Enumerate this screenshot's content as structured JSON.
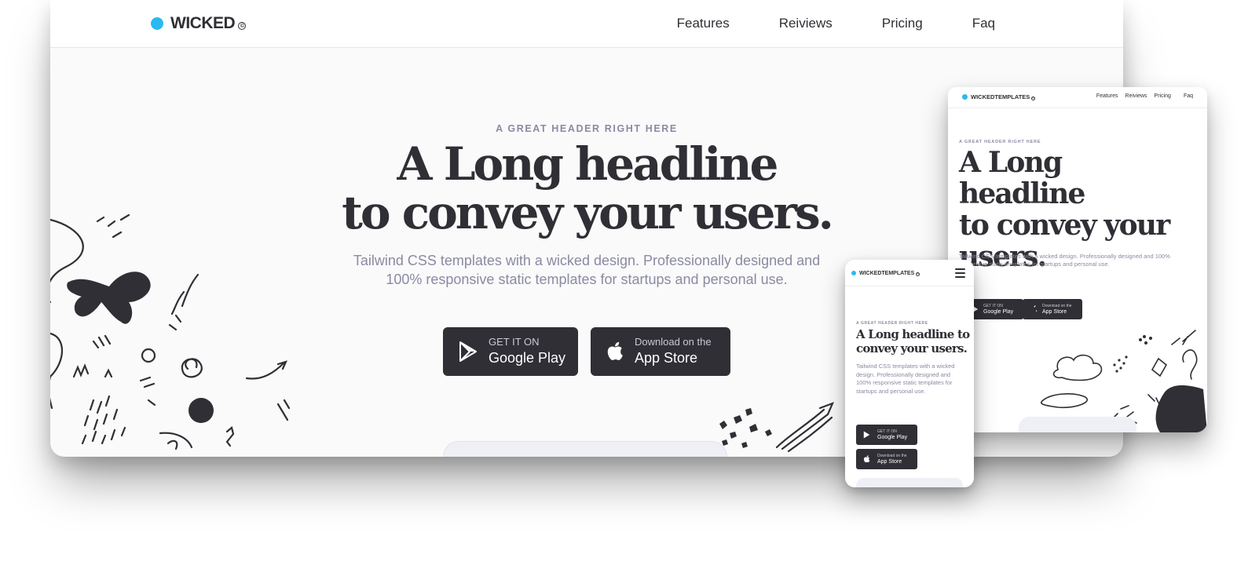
{
  "colors": {
    "accent": "#2ab9f0",
    "dark": "#2f2f35",
    "muted": "#8a8aa3",
    "background": "#fafafa"
  },
  "desktop": {
    "brand": "WICKED",
    "brand_mark": "©",
    "nav": [
      "Features",
      "Reiviews",
      "Pricing",
      "Faq"
    ],
    "eyebrow": "A GREAT HEADER RIGHT HERE",
    "headline_line1": "A Long headline",
    "headline_line2": "to convey your users.",
    "subtext_line1": "Tailwind CSS templates with a wicked design. Professionally designed and",
    "subtext_line2": "100% responsive static templates for startups and personal use.",
    "google_play": {
      "small": "GET IT ON",
      "big": "Google Play",
      "icon": "google-play-icon"
    },
    "app_store": {
      "small": "Download on the",
      "big": "App Store",
      "icon": "apple-icon"
    }
  },
  "tablet": {
    "brand": "WICKEDTEMPLATES",
    "brand_mark": "©",
    "nav": [
      "Features",
      "Reiviews",
      "Pricing",
      "Faq"
    ],
    "eyebrow": "A GREAT HEADER RIGHT HERE",
    "headline_line1": "A Long headline",
    "headline_line2": "to convey your",
    "headline_line3": "users.",
    "subtext_line1": "Tailwind CSS templates with a wicked design. Professionally designed and 100%",
    "subtext_line2": "responsive static templates for startups and personal use.",
    "google_play": {
      "small": "GET IT ON",
      "big": "Google Play"
    },
    "app_store": {
      "small": "Download on the",
      "big": "App Store"
    }
  },
  "phone": {
    "brand": "WICKEDTEMPLATES",
    "brand_mark": "©",
    "menu_icon": "hamburger-menu-icon",
    "eyebrow": "A GREAT HEADER RIGHT HERE",
    "headline_line1": "A Long headline to",
    "headline_line2": "convey your users.",
    "subtext": "Tailwind CSS templates with a wicked design. Professionally designed and 100% responsive static templates for startups and personal use.",
    "google_play": {
      "small": "GET IT ON",
      "big": "Google Play"
    },
    "app_store": {
      "small": "Download on the",
      "big": "App Store"
    }
  }
}
